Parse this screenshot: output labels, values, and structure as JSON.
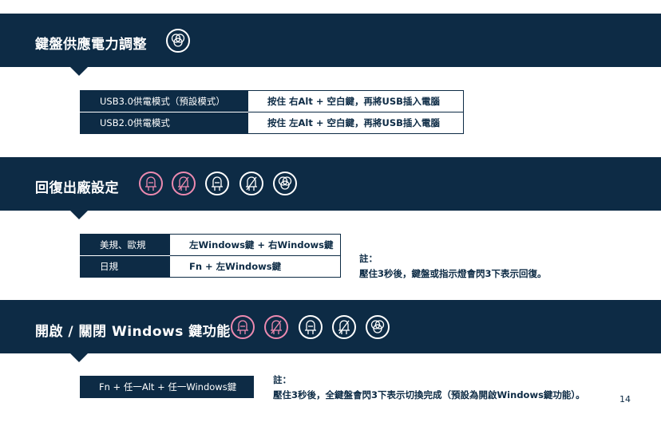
{
  "sections": {
    "power": {
      "title": "鍵盤供應電力調整",
      "rows": [
        {
          "label": "USB3.0供電模式（預設模式）",
          "value": "按住 右Alt + 空白鍵，再將USB插入電腦"
        },
        {
          "label": "USB2.0供電模式",
          "value": "按住 左Alt + 空白鍵，再將USB插入電腦"
        }
      ]
    },
    "reset": {
      "title": "回復出廠設定",
      "rows": [
        {
          "label": "美規、歐規",
          "value": "左Windows鍵 + 右Windows鍵"
        },
        {
          "label": "日規",
          "value": "Fn + 左Windows鍵"
        }
      ],
      "note_title": "註：",
      "note_text": "壓住3秒後，鍵盤或指示燈會閃3下表示回復。"
    },
    "winkey": {
      "title": "開啟 / 關閉 Windows 鍵功能",
      "combo": "Fn + 任一Alt + 任一Windows鍵",
      "note_title": "註：",
      "note_text": "壓住3秒後，全鍵盤會閃3下表示切換完成（預設為開啟Windows鍵功能）。"
    }
  },
  "icons": {
    "power": [
      "mode-circles-icon"
    ],
    "reset": [
      "led-icon",
      "led-off-icon",
      "led-icon",
      "led-off-icon",
      "mode-circles-icon"
    ],
    "winkey": [
      "led-icon",
      "led-off-icon",
      "led-icon",
      "led-off-icon",
      "mode-circles-icon"
    ]
  },
  "colors": {
    "navy": "#0d2b45",
    "pink": "#ec8ab0",
    "white": "#ffffff"
  },
  "page_number": "14"
}
